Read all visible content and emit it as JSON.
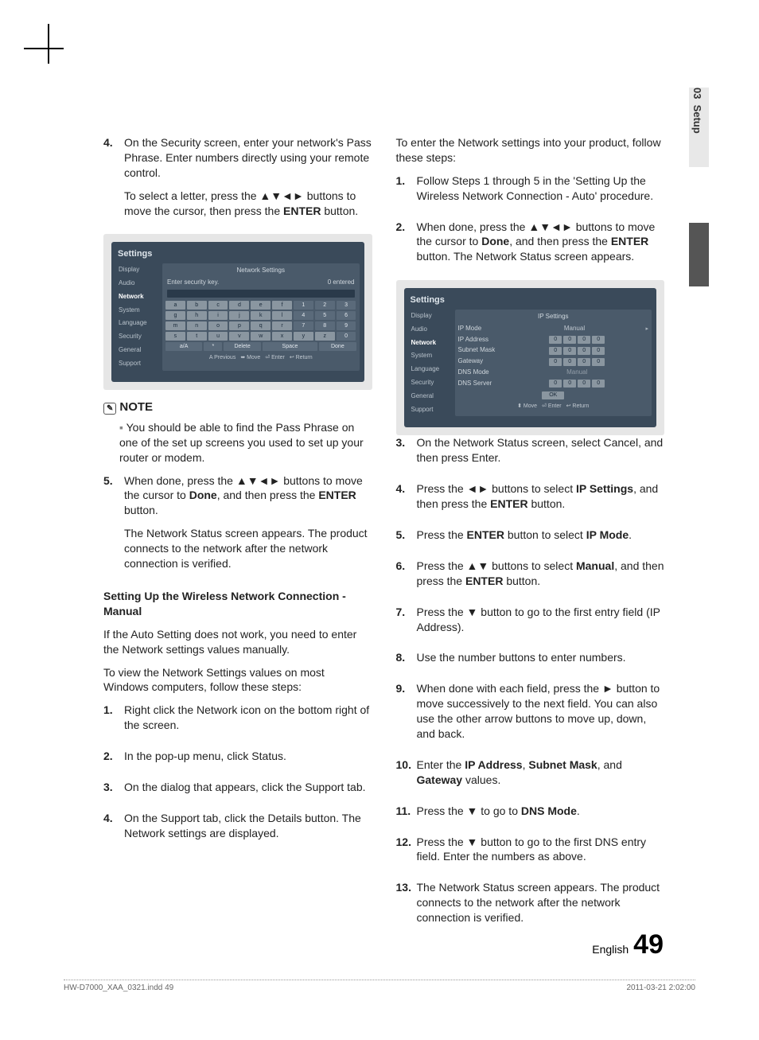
{
  "tab": {
    "chapter": "03",
    "section": "Setup"
  },
  "left": {
    "step4": {
      "num": "4.",
      "a": "On the Security screen, enter your network's Pass Phrase. Enter numbers directly using your remote control.",
      "b1": "To select a letter, press the ",
      "b2": "▲▼◄►",
      "b3": " buttons to move the cursor, then press the ",
      "b4": "ENTER",
      "b5": " button."
    },
    "settings1": {
      "title": "Settings",
      "nav": [
        "Display",
        "Audio",
        "Network",
        "System",
        "Language",
        "Security",
        "General",
        "Support"
      ],
      "active": 2,
      "panel_title": "Network Settings",
      "sec_label": "Enter security key.",
      "sec_count": "0 entered",
      "rows": [
        [
          "a",
          "b",
          "c",
          "d",
          "e",
          "f",
          "1",
          "2",
          "3"
        ],
        [
          "g",
          "h",
          "i",
          "j",
          "k",
          "l",
          "4",
          "5",
          "6"
        ],
        [
          "m",
          "n",
          "o",
          "p",
          "q",
          "r",
          "7",
          "8",
          "9"
        ],
        [
          "s",
          "t",
          "u",
          "v",
          "w",
          "x",
          "y",
          "z",
          "0"
        ]
      ],
      "ctrl_row": [
        "a/A",
        "*",
        "Delete",
        "Space",
        "Done"
      ],
      "hints": [
        "A Previous",
        "⬌ Move",
        "⏎ Enter",
        "↩ Return"
      ]
    },
    "note_head": "NOTE",
    "note_item": "You should be able to find the Pass Phrase on one of the set up screens you used to set up your router or modem.",
    "step5": {
      "num": "5.",
      "a1": "When done, press the ",
      "a2": "▲▼◄►",
      "a3": " buttons to move the cursor to ",
      "a4": "Done",
      "a5": ", and then press the ",
      "a6": "ENTER",
      "a7": " button.",
      "b": "The Network Status screen appears. The product connects to the network after the network connection is verified."
    },
    "h3": "Setting Up the Wireless Network Connection - Manual",
    "p1": "If the Auto Setting does not work, you need to enter the Network settings values manually.",
    "p2": "To view the Network Settings values on most Windows computers, follow these steps:",
    "r1": {
      "num": "1.",
      "t": "Right click the Network icon on the bottom right of the screen."
    },
    "r2": {
      "num": "2.",
      "t": "In the pop-up menu, click Status."
    },
    "r3": {
      "num": "3.",
      "t": "On the dialog that appears, click the Support tab."
    },
    "r4": {
      "num": "4.",
      "t": "On the Support tab, click the Details button. The Network settings are displayed."
    }
  },
  "right": {
    "intro": "To enter the Network settings into your product, follow these steps:",
    "s1": {
      "num": "1.",
      "t": "Follow Steps 1 through 5 in the 'Setting Up the Wireless Network Connection - Auto' procedure."
    },
    "s2": {
      "num": "2.",
      "a1": "When done, press the ",
      "a2": "▲▼◄►",
      "a3": " buttons to move the cursor to ",
      "a4": "Done",
      "a5": ", and then press the ",
      "a6": "ENTER",
      "a7": " button. The Network Status screen appears."
    },
    "settings2": {
      "title": "Settings",
      "nav": [
        "Display",
        "Audio",
        "Network",
        "System",
        "Language",
        "Security",
        "General",
        "Support"
      ],
      "active": 2,
      "panel_title": "IP Settings",
      "rows": [
        {
          "label": "IP Mode",
          "mode": "Manual",
          "caret": "▸"
        },
        {
          "label": "IP Address",
          "boxes": [
            "0",
            "0",
            "0",
            "0"
          ]
        },
        {
          "label": "Subnet Mask",
          "boxes": [
            "0",
            "0",
            "0",
            "0"
          ]
        },
        {
          "label": "Gateway",
          "boxes": [
            "0",
            "0",
            "0",
            "0"
          ]
        },
        {
          "label": "DNS Mode",
          "mode": "Manual"
        },
        {
          "label": "DNS Server",
          "boxes": [
            "0",
            "0",
            "0",
            "0"
          ]
        }
      ],
      "ok": "OK",
      "hints": [
        "⬍ Move",
        "⏎ Enter",
        "↩ Return"
      ]
    },
    "s3": {
      "num": "3.",
      "t": "On the Network Status screen, select Cancel, and then press Enter."
    },
    "s4": {
      "num": "4.",
      "a1": "Press the ",
      "a2": "◄►",
      "a3": " buttons to select ",
      "a4": "IP Settings",
      "a5": ", and then press the ",
      "a6": "ENTER",
      "a7": " button."
    },
    "s5": {
      "num": "5.",
      "a1": "Press the ",
      "a2": "ENTER",
      "a3": " button to select ",
      "a4": "IP Mode",
      "a5": "."
    },
    "s6": {
      "num": "6.",
      "a1": "Press the ",
      "a2": "▲▼",
      "a3": " buttons to select ",
      "a4": "Manual",
      "a5": ", and then press the ",
      "a6": "ENTER",
      "a7": " button."
    },
    "s7": {
      "num": "7.",
      "a1": "Press the ",
      "a2": "▼",
      "a3": " button to go to the first entry field (IP Address)."
    },
    "s8": {
      "num": "8.",
      "t": "Use the number buttons to enter numbers."
    },
    "s9": {
      "num": "9.",
      "a1": "When done with each field, press the ",
      "a2": "►",
      "a3": " button to move successively to the next field. You can also use the other arrow buttons to move up, down, and back."
    },
    "s10": {
      "num": "10.",
      "a1": "Enter the ",
      "a2": "IP Address",
      "a3": ", ",
      "a4": "Subnet Mask",
      "a5": ", and ",
      "a6": "Gateway",
      "a7": " values."
    },
    "s11": {
      "num": "11.",
      "a1": "Press the ",
      "a2": "▼",
      "a3": " to go to ",
      "a4": "DNS Mode",
      "a5": "."
    },
    "s12": {
      "num": "12.",
      "a1": "Press the ",
      "a2": "▼",
      "a3": " button to go to the first DNS entry field. Enter the numbers as above."
    },
    "s13": {
      "num": "13.",
      "t": "The Network Status screen appears. The product connects to the network after the network connection is verified."
    }
  },
  "footer": {
    "lang": "English",
    "page": "49"
  },
  "print": {
    "file": "HW-D7000_XAA_0321.indd   49",
    "stamp": "2011-03-21   2:02:00"
  }
}
